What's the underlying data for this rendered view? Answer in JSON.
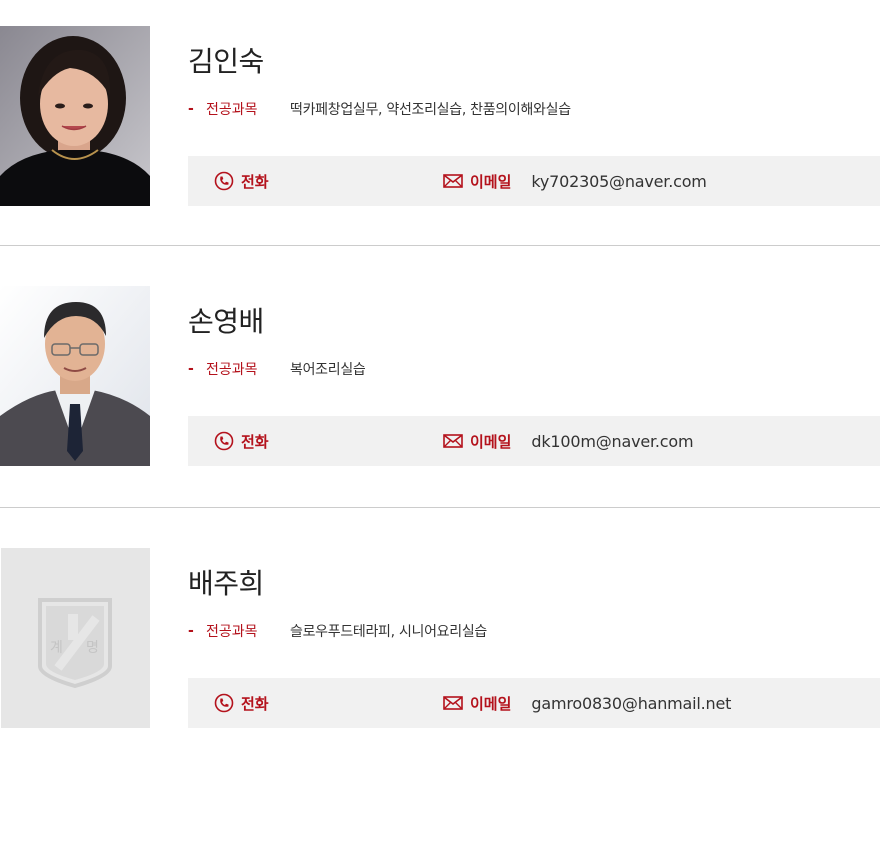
{
  "colors": {
    "accent": "#b4121c",
    "bar_bg": "#f1f1f1",
    "divider": "#cccccc"
  },
  "staff": [
    {
      "name": "김인숙",
      "subject_dash": "-",
      "subject_label": "전공과목",
      "subject_value": "떡카페창업실무, 약선조리실습, 찬품의이해와실습",
      "phone_label": "전화",
      "phone_value": "",
      "email_label": "이메일",
      "email_value": "ky702305@naver.com"
    },
    {
      "name": "손영배",
      "subject_dash": "-",
      "subject_label": "전공과목",
      "subject_value": "복어조리실습",
      "phone_label": "전화",
      "phone_value": "",
      "email_label": "이메일",
      "email_value": "dk100m@naver.com"
    },
    {
      "name": "배주희",
      "subject_dash": "-",
      "subject_label": "전공과목",
      "subject_value": "슬로우푸드테라피, 시니어요리실습",
      "phone_label": "전화",
      "phone_value": "",
      "email_label": "이메일",
      "email_value": "gamro0830@hanmail.net",
      "placeholder_logo_text": [
        "계",
        "명"
      ]
    }
  ],
  "icons": {
    "phone": "phone-icon",
    "email": "envelope-icon",
    "placeholder": "university-emblem-icon"
  }
}
